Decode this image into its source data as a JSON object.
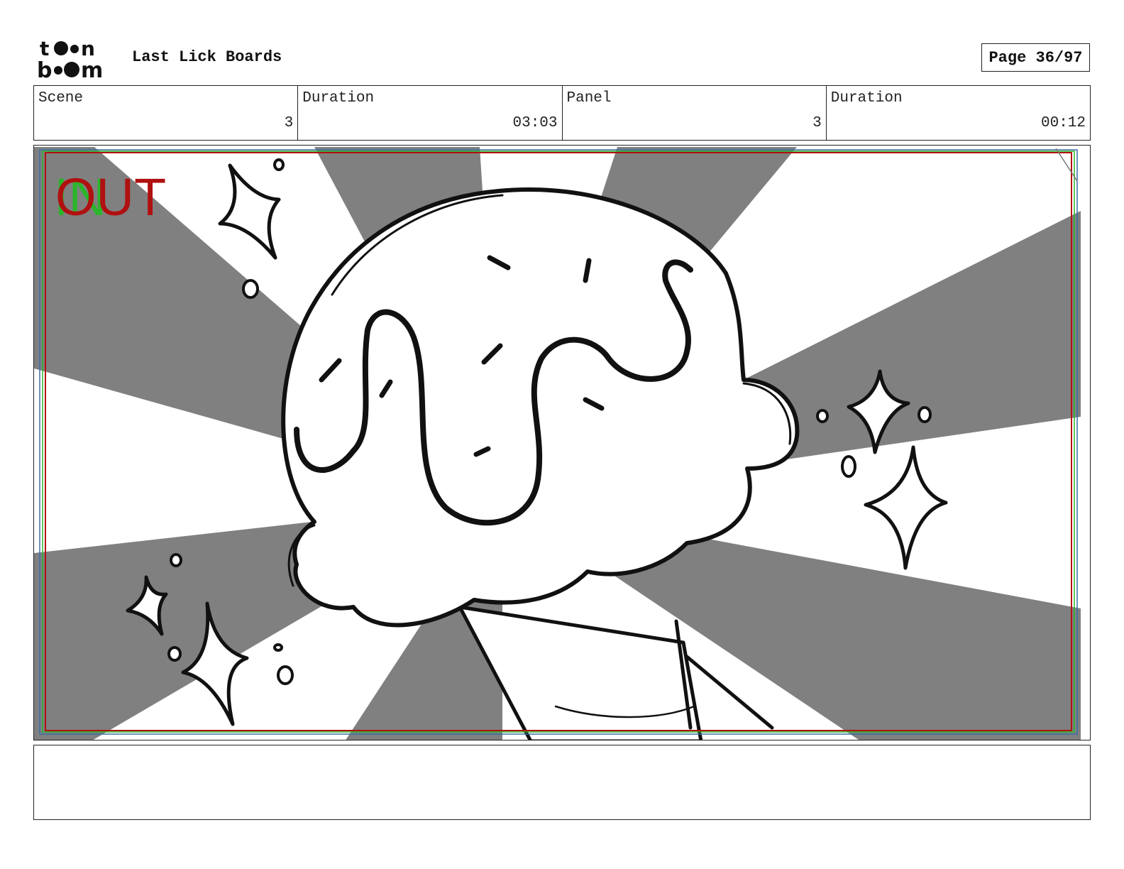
{
  "header": {
    "logo_top": "to•n",
    "logo_bottom": "b••m",
    "title": "Last Lick Boards",
    "page": "Page 36/97"
  },
  "info": [
    {
      "label": "Scene",
      "value": "3"
    },
    {
      "label": "Duration",
      "value": "03:03"
    },
    {
      "label": "Panel",
      "value": "3"
    },
    {
      "label": "Duration",
      "value": "00:12"
    }
  ],
  "panel": {
    "marker_in": "IN",
    "marker_out": "OUT",
    "in_color": "#2bb52b",
    "out_color": "#b01010",
    "ray_color": "#808080"
  },
  "notes": ""
}
